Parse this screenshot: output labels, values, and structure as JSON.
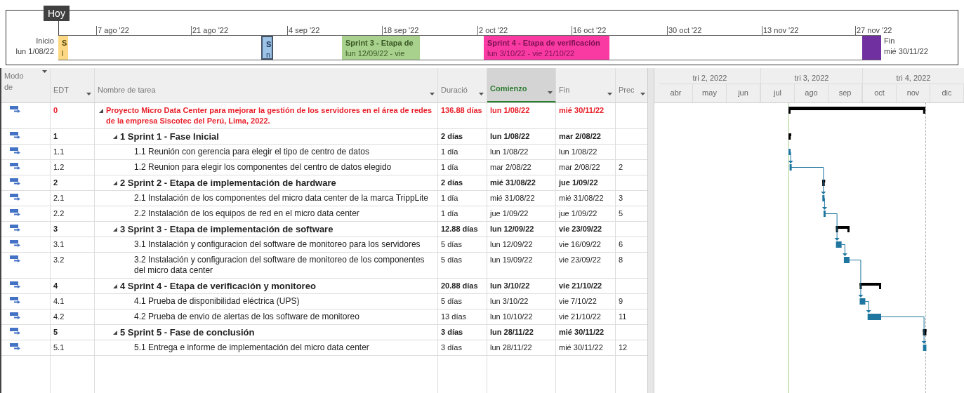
{
  "timeline": {
    "today_label": "Hoy",
    "start": {
      "label": "Inicio",
      "date": "lun 1/08/22"
    },
    "finish": {
      "label": "Fin",
      "date": "mié 30/11/22"
    },
    "ticks": [
      "7 ago '22",
      "21 ago '22",
      "4 sep '22",
      "18 sep '22",
      "2 oct '22",
      "16 oct '22",
      "30 oct '22",
      "13 nov '22",
      "27 nov '22"
    ],
    "bars": [
      {
        "title": "S",
        "dates": "l",
        "color": "#fcd884"
      },
      {
        "title": "S",
        "dates": "n",
        "color": "#9dc3e6"
      },
      {
        "title": "Sprint 3 - Etapa de",
        "dates": "lun 12/09/22 - vie",
        "color": "#a9d18e"
      },
      {
        "title": "Sprint 4 - Etapa de verificación",
        "dates": "lun 3/10/22 - vie 21/10/22",
        "color": "#f93aa3"
      },
      {
        "color": "#7030a0"
      }
    ]
  },
  "table": {
    "columns": [
      {
        "label": "Modo de",
        "selected": false
      },
      {
        "label": "EDT",
        "selected": false
      },
      {
        "label": "Nombre de tarea",
        "selected": false
      },
      {
        "label": "Duració",
        "selected": false
      },
      {
        "label": "Comienzo",
        "selected": true
      },
      {
        "label": "Fin",
        "selected": false
      },
      {
        "label": "Prec",
        "selected": false
      }
    ],
    "tasks": [
      {
        "edt": "0",
        "name": "Proyecto Micro Data Center para mejorar la gestión de los servidores en el área de redes de la empresa Siscotec del Perú, Lima, 2022.",
        "duration": "136.88 días",
        "start": "lun 1/08/22",
        "finish": "mié 30/11/22",
        "expanded": true,
        "children": [
          {
            "edt": "1",
            "name": "1 Sprint 1 - Fase Inicial",
            "duration": "2 días",
            "start": "lun 1/08/22",
            "finish": "mar 2/08/22",
            "expanded": true,
            "children": [
              {
                "edt": "1.1",
                "name": "1.1 Reunión con gerencia para elegir el tipo de centro de datos",
                "duration": "1 día",
                "start": "lun 1/08/22",
                "finish": "lun 1/08/22"
              },
              {
                "edt": "1.2",
                "name": "1.2 Reunion para elegir los componentes del centro de datos elegido",
                "duration": "1 día",
                "start": "mar 2/08/22",
                "finish": "mar 2/08/22",
                "pred": "2"
              }
            ]
          },
          {
            "edt": "2",
            "name": "2 Sprint 2 - Etapa de implementación de hardware",
            "duration": "2 días",
            "start": "mié 31/08/22",
            "finish": "jue 1/09/22",
            "expanded": true,
            "children": [
              {
                "edt": "2.1",
                "name": "2.1 Instalación de los componentes del micro data center de la marca TrippLite",
                "duration": "1 día",
                "start": "mié 31/08/22",
                "finish": "mié 31/08/22",
                "pred": "3"
              },
              {
                "edt": "2.2",
                "name": "2.2 Instalación de los equipos de red en el micro data center",
                "duration": "1 día",
                "start": "jue 1/09/22",
                "finish": "jue 1/09/22",
                "pred": "5"
              }
            ]
          },
          {
            "edt": "3",
            "name": "3 Sprint 3 - Etapa de implementación de software",
            "duration": "12.88 días",
            "start": "lun 12/09/22",
            "finish": "vie 23/09/22",
            "expanded": true,
            "children": [
              {
                "edt": "3.1",
                "name": "3.1 Instalación y configuracion del software de monitoreo para los servidores",
                "duration": "5 días",
                "start": "lun 12/09/22",
                "finish": "vie 16/09/22",
                "pred": "6"
              },
              {
                "edt": "3.2",
                "name": "3.2 Instalación y configuracion del software de monitoreo de los componentes del micro data center",
                "duration": "5 días",
                "start": "lun 19/09/22",
                "finish": "vie 23/09/22",
                "pred": "8"
              }
            ]
          },
          {
            "edt": "4",
            "name": "4 Sprint 4 - Etapa de verificación y monitoreo",
            "duration": "20.88 días",
            "start": "lun 3/10/22",
            "finish": "vie 21/10/22",
            "expanded": true,
            "children": [
              {
                "edt": "4.1",
                "name": "4.1 Prueba de disponibilidad eléctrica (UPS)",
                "duration": "5 días",
                "start": "lun 3/10/22",
                "finish": "vie 7/10/22",
                "pred": "9"
              },
              {
                "edt": "4.2",
                "name": "4.2 Prueba de envio de alertas de los software de monitoreo",
                "duration": "13 días",
                "start": "lun 10/10/22",
                "finish": "vie 21/10/22",
                "pred": "11"
              }
            ]
          },
          {
            "edt": "5",
            "name": "5 Sprint 5 - Fase de conclusión",
            "duration": "3 días",
            "start": "lun 28/11/22",
            "finish": "mié 30/11/22",
            "expanded": true,
            "children": [
              {
                "edt": "5.1",
                "name": "5.1 Entrega e informe de implementación del micro data center",
                "duration": "3 días",
                "start": "lun 28/11/22",
                "finish": "mié 30/11/22",
                "pred": "12"
              }
            ]
          }
        ]
      }
    ]
  },
  "gantt": {
    "quarters": [
      {
        "label": "tri 2, 2022",
        "months": [
          "abr",
          "may",
          "jun"
        ]
      },
      {
        "label": "tri 3, 2022",
        "months": [
          "jul",
          "ago",
          "sep"
        ]
      },
      {
        "label": "tri 4, 2022",
        "months": [
          "oct",
          "nov",
          "dic"
        ]
      }
    ]
  }
}
